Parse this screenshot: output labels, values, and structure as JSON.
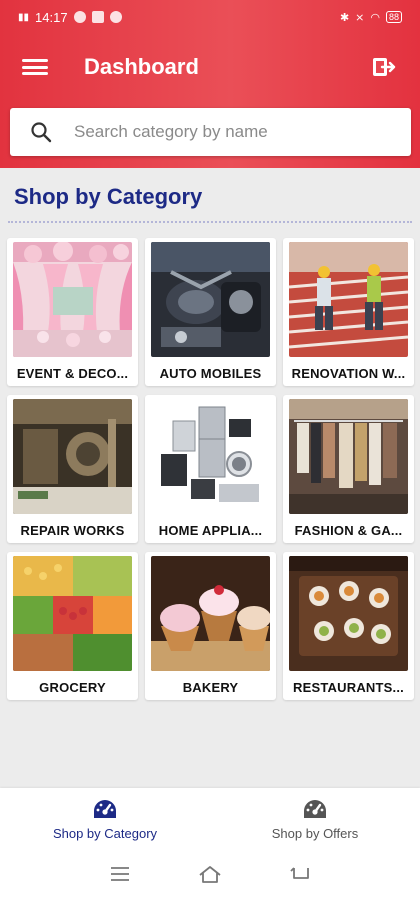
{
  "status_bar": {
    "time": "14:17",
    "battery": "88"
  },
  "app_bar": {
    "title": "Dashboard"
  },
  "search": {
    "placeholder": "Search category by name"
  },
  "section": {
    "title": "Shop by Category"
  },
  "categories": [
    {
      "label": "EVENT & DECO...",
      "icon": "event-decoration-photo"
    },
    {
      "label": "AUTO MOBILES",
      "icon": "automobile-engine-photo"
    },
    {
      "label": "RENOVATION W...",
      "icon": "renovation-workers-photo"
    },
    {
      "label": "REPAIR WORKS",
      "icon": "repair-workshop-photo"
    },
    {
      "label": "HOME APPLIA...",
      "icon": "home-appliances-photo"
    },
    {
      "label": "FASHION & GA...",
      "icon": "fashion-garments-photo"
    },
    {
      "label": "GROCERY",
      "icon": "grocery-produce-photo"
    },
    {
      "label": "BAKERY",
      "icon": "bakery-cupcakes-photo"
    },
    {
      "label": "RESTAURANTS...",
      "icon": "restaurant-dining-photo"
    }
  ],
  "bottom_nav": {
    "items": [
      {
        "label": "Shop by Category",
        "icon": "dashboard-gauge-icon",
        "active": true
      },
      {
        "label": "Shop by Offers",
        "icon": "dashboard-gauge-icon",
        "active": false
      }
    ]
  },
  "colors": {
    "primary": "#e2333f",
    "accent_text": "#1d2a86",
    "background": "#ececec"
  }
}
